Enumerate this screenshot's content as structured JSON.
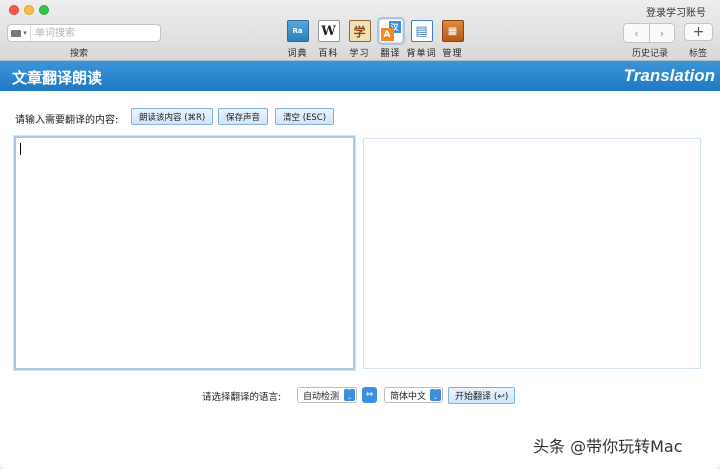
{
  "toolbar": {
    "login_link": "登录学习账号",
    "search": {
      "placeholder": "单词搜索",
      "label": "搜索"
    },
    "tools": [
      {
        "label": "词典",
        "icon": "dictionary-icon",
        "glyph": "Ra"
      },
      {
        "label": "百科",
        "icon": "wikipedia-icon",
        "glyph": "W"
      },
      {
        "label": "学习",
        "icon": "study-book-icon",
        "glyph": "学"
      },
      {
        "label": "翻译",
        "icon": "translate-icon",
        "glyph_a": "A",
        "glyph_z": "汉"
      },
      {
        "label": "背单词",
        "icon": "flashcard-book-icon",
        "glyph": "▤"
      },
      {
        "label": "管理",
        "icon": "manage-cabinet-icon",
        "glyph": "▦"
      }
    ],
    "active_tool": "翻译",
    "history": {
      "back": "‹",
      "forward": "›",
      "label": "历史记录"
    },
    "bookmark": {
      "add": "+",
      "label": "标签"
    }
  },
  "header": {
    "title": "文章翻译朗读",
    "title_en": "Translation",
    "color": "#2580c8"
  },
  "content": {
    "input_prompt": "请输入需要翻译的内容:",
    "buttons": {
      "read": "朗读该内容 (⌘R)",
      "save": "保存声音",
      "clear": "清空 (ESC)"
    },
    "source_text": "",
    "translation_text": "",
    "language_prompt": "请选择翻译的语言:",
    "source_language": "自动检测",
    "swap": "⇔",
    "target_language": "简体中文",
    "start_button": "开始翻译 (↩)"
  },
  "watermark": "头条 @带你玩转Mac"
}
